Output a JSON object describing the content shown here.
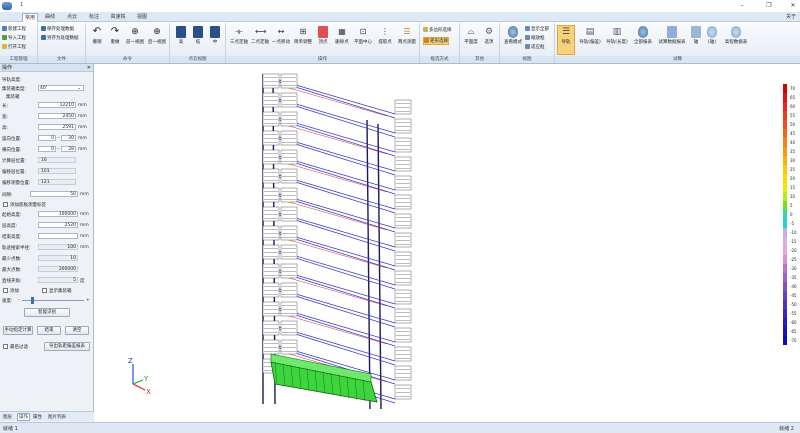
{
  "window": {
    "title": "1",
    "min_icon": "minimize-icon",
    "max_icon": "restore-icon",
    "close_icon": "close-icon"
  },
  "tabs": [
    "常用",
    "曲线",
    "点云",
    "标注",
    "高速铁",
    "视图"
  ],
  "about": "关于",
  "ribbon": {
    "file_group": {
      "label": "工程管理",
      "items": [
        "新建工程",
        "导入工程",
        "打开工程"
      ]
    },
    "file2_group": {
      "label": "文件",
      "items": [
        "保存处理数据",
        "另存为处理数据"
      ]
    },
    "cmd_group": {
      "label": "命令",
      "items": [
        "撤销",
        "重做",
        "前一视图",
        "后一视图"
      ]
    },
    "view_group": {
      "label": "点云视图",
      "items": [
        "高",
        "低",
        "中"
      ]
    },
    "op_group": {
      "label": "操作",
      "items": [
        "三点定轴",
        "二点定轴",
        "一点移动",
        "简单调整",
        "顶点",
        "删除点",
        "平面中心",
        "提取点",
        "两点测量"
      ]
    },
    "sel_group": {
      "label": "框选方式",
      "items": [
        "多边形选择",
        "矩形选择"
      ]
    },
    "other_group": {
      "label": "其他",
      "items": [
        "平面度",
        "选项"
      ]
    },
    "vision_group": {
      "label": "视图",
      "items": [
        "查看模式",
        "显示全部",
        "缩放框",
        "适应框"
      ]
    },
    "test_group": {
      "label": "试算",
      "items": [
        "导轨",
        "导轨(偏差)",
        "导轨(长度)",
        "全部报表",
        "试算数据报表",
        "轴",
        "(轴)",
        "高程数据表"
      ]
    }
  },
  "panel": {
    "title": "操作",
    "section": "导轨高度:",
    "rail_type_label": "集装箱类型:",
    "rail_type_value": "40'",
    "container_label": "集装箱",
    "fields": [
      {
        "label": "长:",
        "value": "12210",
        "unit": "mm"
      },
      {
        "label": "宽:",
        "value": "2450",
        "unit": "mm"
      },
      {
        "label": "高:",
        "value": "2591",
        "unit": "mm"
      }
    ],
    "vert_label": "竖向位置:",
    "vert_a": "0",
    "vert_b": "30",
    "horiz_label": "横向位置:",
    "horiz_a": "0",
    "horiz_b": "28",
    "ro_fields": [
      {
        "label": "计算层位置:",
        "value": "16"
      },
      {
        "label": "偏移层位置:",
        "value": "101"
      },
      {
        "label": "偏移测量位置:",
        "value": "121"
      }
    ],
    "gap_label": "间隙:",
    "gap_value": "50",
    "gap_unit": "mm",
    "check_label": "添加底板测量标签",
    "start_label": "起始高度:",
    "start_value": "100000",
    "start_unit": "mm",
    "layer_label": "层高度:",
    "layer_value": "2520",
    "layer_unit": "mm",
    "end_label": "结束高度:",
    "end_value": "",
    "end_unit": "mm",
    "radius_label": "轨迹搜索半径:",
    "radius_value": "100",
    "radius_unit": "mm",
    "min_pts_label": "最少点数:",
    "min_pts_value": "10",
    "max_pts_label": "最大点数:",
    "max_pts_value": "200000",
    "angle_label": "直线夹角:",
    "angle_value": "5",
    "angle_unit": "度",
    "add_label": "添加",
    "show_label": "显示集装箱",
    "speed_label": "速度:",
    "calc_button": "智能识别",
    "manual_button": "手动指定计算",
    "finish_button": "结束",
    "clear_button": "清空",
    "last_check": "最后过滤",
    "export_button": "导出轨距偏差报表"
  },
  "panel_tabs": [
    "图层",
    "操作",
    "属性",
    "图片列表"
  ],
  "status": {
    "left": "就绪 1",
    "right": "就绪 2"
  },
  "legend": [
    {
      "label": "70",
      "color": "#d40000"
    },
    {
      "label": "65",
      "color": "#e01010"
    },
    {
      "label": "60",
      "color": "#e82828"
    },
    {
      "label": "55",
      "color": "#ee3c1e"
    },
    {
      "label": "50",
      "color": "#f0501c"
    },
    {
      "label": "45",
      "color": "#f26a18"
    },
    {
      "label": "40",
      "color": "#f58214"
    },
    {
      "label": "35",
      "color": "#f79a12"
    },
    {
      "label": "30",
      "color": "#f9b10e"
    },
    {
      "label": "25",
      "color": "#fbc80a"
    },
    {
      "label": "20",
      "color": "#fbdb06"
    },
    {
      "label": "15",
      "color": "#e6ee08"
    },
    {
      "label": "10",
      "color": "#b8ee10"
    },
    {
      "label": "5",
      "color": "#70e020"
    },
    {
      "label": "0",
      "color": "#30d6b0"
    },
    {
      "label": "-5",
      "color": "#20d0d8"
    },
    {
      "label": "-10",
      "color": "#c0b0e8"
    },
    {
      "label": "-15",
      "color": "#d8b0e4"
    },
    {
      "label": "-20",
      "color": "#e4a8d8"
    },
    {
      "label": "-25",
      "color": "#d890d0"
    },
    {
      "label": "-30",
      "color": "#c070c8"
    },
    {
      "label": "-35",
      "color": "#a060c4"
    },
    {
      "label": "-40",
      "color": "#8050c0"
    },
    {
      "label": "-45",
      "color": "#6a40c0"
    },
    {
      "label": "-50",
      "color": "#5432c0"
    },
    {
      "label": "-55",
      "color": "#3e24c0"
    },
    {
      "label": "-60",
      "color": "#2c18c2"
    },
    {
      "label": "-65",
      "color": "#1c10c4"
    },
    {
      "label": "-70",
      "color": "#1008c8"
    }
  ],
  "axes": {
    "x": "X",
    "y": "Y",
    "z": "Z"
  }
}
